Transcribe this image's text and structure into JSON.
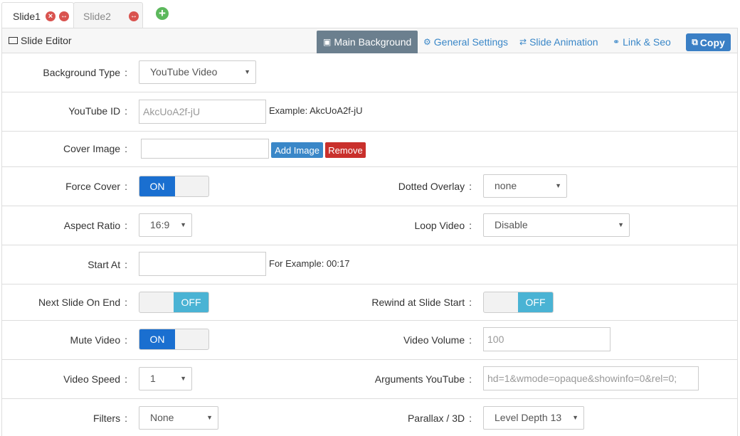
{
  "tabs": [
    {
      "label": "Slide1",
      "active": true
    },
    {
      "label": "Slide2",
      "active": false
    }
  ],
  "icons": {
    "close": "×",
    "move": "↔",
    "add": "+"
  },
  "editor": {
    "title": "Slide Editor",
    "header_tabs": [
      {
        "label": "Main Background",
        "icon": "image-icon",
        "active": true
      },
      {
        "label": "General Settings",
        "icon": "gear-icon",
        "active": false
      },
      {
        "label": "Slide Animation",
        "icon": "shuffle-icon",
        "active": false
      },
      {
        "label": "Link & Seo",
        "icon": "link-icon",
        "active": false
      }
    ],
    "copy_label": "Copy"
  },
  "fields": {
    "background_type": {
      "label": "Background Type",
      "value": "YouTube Video"
    },
    "youtube_id": {
      "label": "YouTube ID",
      "value": "AkcUoA2f-jU",
      "hint": "Example: AkcUoA2f-jU"
    },
    "cover_image": {
      "label": "Cover Image",
      "value": "",
      "add_label": "Add Image",
      "remove_label": "Remove"
    },
    "force_cover": {
      "label": "Force Cover",
      "state": "ON"
    },
    "dotted_overlay": {
      "label": "Dotted Overlay",
      "value": "none"
    },
    "aspect_ratio": {
      "label": "Aspect Ratio",
      "value": "16:9"
    },
    "loop_video": {
      "label": "Loop Video",
      "value": "Disable"
    },
    "start_at": {
      "label": "Start At",
      "value": "",
      "hint": "For Example: 00:17"
    },
    "next_slide_on_end": {
      "label": "Next Slide On End",
      "state": "OFF"
    },
    "rewind_at_slide_start": {
      "label": "Rewind at Slide Start",
      "state": "OFF"
    },
    "mute_video": {
      "label": "Mute Video",
      "state": "ON"
    },
    "video_volume": {
      "label": "Video Volume",
      "value": "100"
    },
    "video_speed": {
      "label": "Video Speed",
      "value": "1"
    },
    "arguments_youtube": {
      "label": "Arguments YouTube",
      "value": "hd=1&wmode=opaque&showinfo=0&rel=0;"
    },
    "filters": {
      "label": "Filters",
      "value": "None"
    },
    "parallax_3d": {
      "label": "Parallax / 3D",
      "value": "Level Depth 13"
    }
  },
  "separator": ":"
}
